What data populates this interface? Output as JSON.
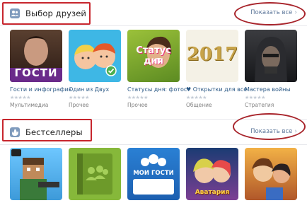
{
  "sections": [
    {
      "title": "Выбор друзей",
      "show_all": "Показать все",
      "icon": "friends-icon",
      "apps": [
        {
          "name": "Гости и инфографика!",
          "category": "Мультимедиа",
          "thumb_text": "ГОСТИ",
          "icon": "guests-app-icon"
        },
        {
          "name": "Один из Двух",
          "category": "Прочее",
          "thumb_text": "",
          "icon": "two-faces-app-icon"
        },
        {
          "name": "Статусы дня: фотостатусы",
          "category": "Прочее",
          "thumb_text": "Статус дня",
          "icon": "status-app-icon"
        },
        {
          "name": "♥ Открытки для всех",
          "category": "Общение",
          "thumb_text": "2017",
          "icon": "postcards-app-icon"
        },
        {
          "name": "Мастера войны",
          "category": "Стратегия",
          "thumb_text": "",
          "icon": "war-masters-app-icon"
        }
      ]
    },
    {
      "title": "Бестселлеры",
      "show_all": "Показать все",
      "icon": "fire-icon",
      "apps": [
        {
          "name": "",
          "category": "",
          "thumb_text": "",
          "icon": "blocky-shooter-app-icon"
        },
        {
          "name": "",
          "category": "",
          "thumb_text": "",
          "icon": "contacts-book-app-icon"
        },
        {
          "name": "",
          "category": "",
          "thumb_text": "МОИ ГОСТИ",
          "icon": "my-guests-app-icon"
        },
        {
          "name": "",
          "category": "",
          "thumb_text": "Аватария",
          "icon": "avataria-app-icon"
        },
        {
          "name": "",
          "category": "",
          "thumb_text": "",
          "icon": "heroes-app-icon"
        }
      ]
    }
  ],
  "colors": {
    "link": "#2a5885",
    "accent_annotation": "#c7262d",
    "header_icon": "#7f9bbd"
  }
}
